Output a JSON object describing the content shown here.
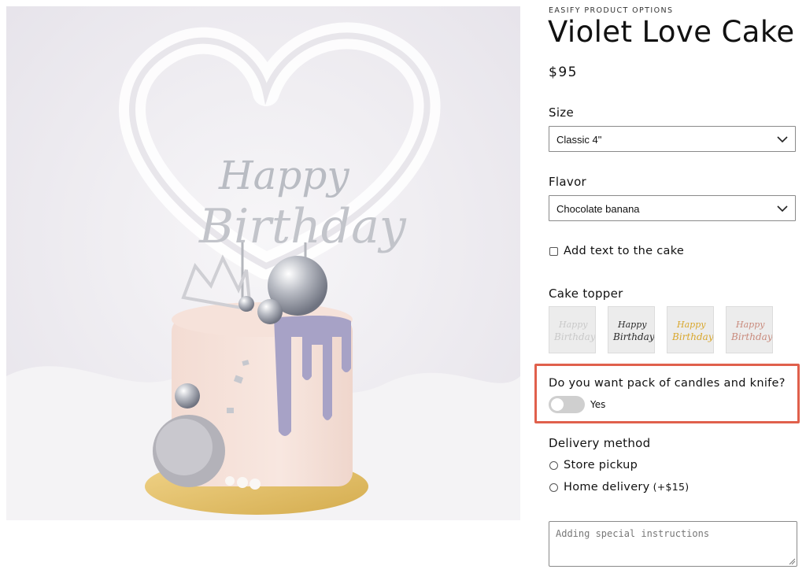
{
  "product": {
    "eyebrow": "EASIFY PRODUCT OPTIONS",
    "title": "Violet Love Cake",
    "price": "$95",
    "image_icon": "cake-photo"
  },
  "options": {
    "size": {
      "label": "Size",
      "value": "Classic 4\""
    },
    "flavor": {
      "label": "Flavor",
      "value": "Chocolate banana"
    },
    "add_text": {
      "label": "Add text to the cake",
      "checked": false
    },
    "cake_topper": {
      "label": "Cake topper",
      "items": [
        {
          "name": "silver",
          "text_top": "Happy",
          "text_bottom": "Birthday",
          "color": "#c9c9c9"
        },
        {
          "name": "black",
          "text_top": "Happy",
          "text_bottom": "Birthday",
          "color": "#2a2a2a"
        },
        {
          "name": "gold",
          "text_top": "Happy",
          "text_bottom": "Birthday",
          "color": "#d9a72c"
        },
        {
          "name": "rose-gold",
          "text_top": "Happy",
          "text_bottom": "Birthday",
          "color": "#c98a7c"
        }
      ]
    },
    "candles_knife": {
      "question": "Do you want pack of candles and knife?",
      "toggle_label": "Yes",
      "on": false
    },
    "delivery": {
      "label": "Delivery method",
      "options": [
        {
          "label": "Store pickup",
          "extra": "",
          "selected": false
        },
        {
          "label": "Home delivery",
          "extra": "(+$15)",
          "selected": false
        }
      ]
    },
    "instructions": {
      "placeholder": "Adding special instructions",
      "value": ""
    }
  },
  "colors": {
    "highlight": "#e0604c",
    "toggle_off": "#cfcfcf",
    "border": "#8a8a8a"
  }
}
